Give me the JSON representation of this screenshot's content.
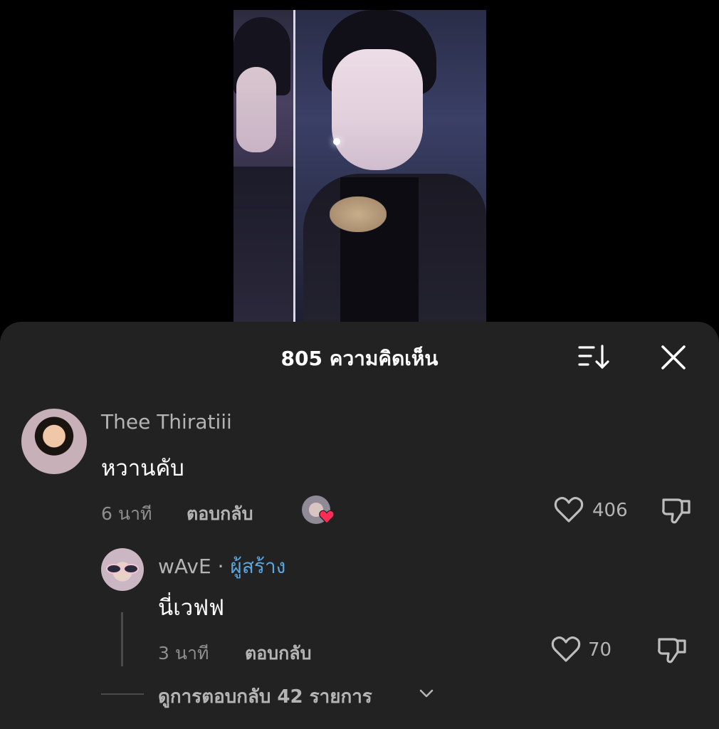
{
  "header": {
    "title": "805 ความคิดเห็น"
  },
  "icons": {
    "sort": "sort-icon",
    "close": "close-icon",
    "like": "heart-outline-icon",
    "dislike": "thumbs-down-icon",
    "chevron": "chevron-down-icon"
  },
  "comment": {
    "username": "Thee Thiratiii",
    "text": "หวานคับ",
    "time": "6 นาที",
    "reply_label": "ตอบกลับ",
    "likes": "406"
  },
  "reply": {
    "username": "wAvE",
    "separator": "·",
    "creator_label": "ผู้สร้าง",
    "text": "นี่เวฟฟ",
    "time": "3 นาที",
    "reply_label": "ตอบกลับ",
    "likes": "70"
  },
  "view_replies": {
    "label": "ดูการตอบกลับ 42 รายการ"
  },
  "colors": {
    "sheet_bg": "#222222",
    "creator_tag": "#5aa6e0",
    "heart_badge": "#ff2d55"
  }
}
